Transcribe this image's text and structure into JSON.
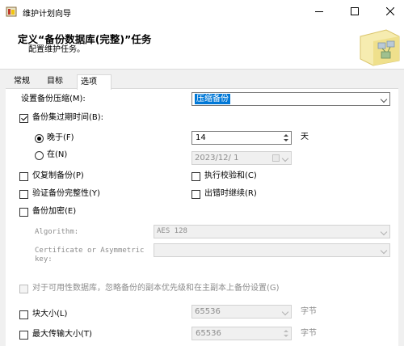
{
  "window": {
    "title": "维护计划向导"
  },
  "header": {
    "title": "定义“备份数据库(完整)”任务",
    "subtitle": "配置维护任务。"
  },
  "tabs": [
    {
      "label": "常规"
    },
    {
      "label": "目标"
    },
    {
      "label": "选项"
    }
  ],
  "compression": {
    "label": "设置备份压缩(M):",
    "value": "压缩备份"
  },
  "expire": {
    "label": "备份集过期时间(B):",
    "checked": true,
    "after_label": "晚于(F)",
    "after_value": "14",
    "after_unit": "天",
    "on_label": "在(N)",
    "on_value": "2023/12/ 1"
  },
  "options": {
    "copy_only": "仅复制备份(P)",
    "checksum": "执行校验和(C)",
    "verify": "验证备份完整性(Y)",
    "continue_on_error": "出错时继续(R)",
    "encrypt": "备份加密(E)"
  },
  "encryption": {
    "algorithm_label": "Algorithm:",
    "algorithm_value": "AES 128",
    "cert_label_1": "Certificate or Asymmetric",
    "cert_label_2": "key:"
  },
  "availability": {
    "label": "对于可用性数据库，忽略备份的副本优先级和在主副本上备份设置(G)"
  },
  "block_size": {
    "label": "块大小(L)",
    "value": "65536",
    "unit": "字节"
  },
  "max_transfer": {
    "label": "最大传输大小(T)",
    "value": "65536",
    "unit": "字节"
  },
  "colors": {
    "selection": "#0078d7",
    "window_bg": "#f0f0f0",
    "panel_bg": "#ffffff"
  }
}
